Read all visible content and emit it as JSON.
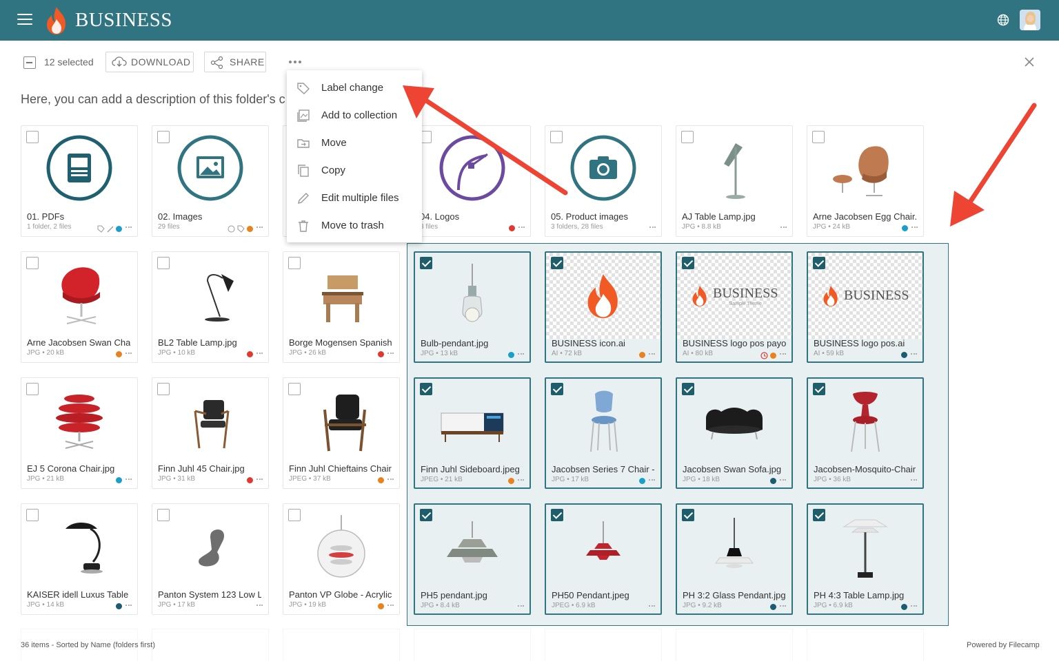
{
  "header": {
    "brand": "BUSINESS",
    "menu_icon": "hamburger-icon",
    "globe_icon": "globe-icon",
    "avatar": "user-avatar",
    "color": "#2f7480"
  },
  "toolbar": {
    "selected_text": "12 selected",
    "download_label": "DOWNLOAD",
    "share_label": "SHARE"
  },
  "description": "Here, you can add a description of this folder's c",
  "context_menu": {
    "items": [
      {
        "label": "Label change",
        "icon": "tag-icon"
      },
      {
        "label": "Add to collection",
        "icon": "collection-icon"
      },
      {
        "label": "Move",
        "icon": "move-icon"
      },
      {
        "label": "Copy",
        "icon": "copy-icon"
      },
      {
        "label": "Edit multiple files",
        "icon": "pencil-icon"
      },
      {
        "label": "Move to trash",
        "icon": "trash-icon"
      }
    ]
  },
  "files": [
    {
      "name": "01. PDFs",
      "meta": "1 folder, 2 files",
      "selected": false
    },
    {
      "name": "02. Images",
      "meta": "29 files",
      "selected": false
    },
    {
      "name": "04. Logos",
      "meta": "3 files",
      "selected": false
    },
    {
      "name": "05. Product images",
      "meta": "3 folders, 28 files",
      "selected": false
    },
    {
      "name": "AJ Table Lamp.jpg",
      "meta": "JPG • 8.8 kB",
      "selected": false
    },
    {
      "name": "Arne Jacobsen Egg Chair.",
      "meta": "JPG • 24 kB",
      "selected": false
    },
    {
      "name": "Arne Jacobsen Swan Chai",
      "meta": "JPG • 20 kB",
      "selected": false
    },
    {
      "name": "BL2 Table Lamp.jpg",
      "meta": "JPG • 10 kB",
      "selected": false
    },
    {
      "name": "Borge Mogensen Spanish",
      "meta": "JPG • 26 kB",
      "selected": false
    },
    {
      "name": "Bulb-pendant.jpg",
      "meta": "JPG • 13 kB",
      "selected": true
    },
    {
      "name": "BUSINESS icon.ai",
      "meta": "AI • 72 kB",
      "selected": true
    },
    {
      "name": "BUSINESS logo pos payof",
      "meta": "AI • 80 kB",
      "selected": true
    },
    {
      "name": "BUSINESS logo pos.ai",
      "meta": "AI • 59 kB",
      "selected": true
    },
    {
      "name": "EJ 5 Corona Chair.jpg",
      "meta": "JPG • 21 kB",
      "selected": false
    },
    {
      "name": "Finn Juhl 45 Chair.jpg",
      "meta": "JPG • 31 kB",
      "selected": false
    },
    {
      "name": "Finn Juhl Chieftains Chair",
      "meta": "JPEG • 37 kB",
      "selected": false
    },
    {
      "name": "Finn Juhl Sideboard.jpeg",
      "meta": "JPEG • 21 kB",
      "selected": true
    },
    {
      "name": "Jacobsen Series 7 Chair -",
      "meta": "JPG • 17 kB",
      "selected": true
    },
    {
      "name": "Jacobsen Swan Sofa.jpg",
      "meta": "JPG • 18 kB",
      "selected": true
    },
    {
      "name": "Jacobsen-Mosquito-Chair",
      "meta": "JPG • 36 kB",
      "selected": true
    },
    {
      "name": "KAISER idell Luxus Table L",
      "meta": "JPG • 14 kB",
      "selected": false
    },
    {
      "name": "Panton System 123 Low L",
      "meta": "JPG • 17 kB",
      "selected": false
    },
    {
      "name": "Panton VP Globe - Acrylic",
      "meta": "JPG • 19 kB",
      "selected": false
    },
    {
      "name": "PH5 pendant.jpg",
      "meta": "JPG • 8.4 kB",
      "selected": true
    },
    {
      "name": "PH50 Pendant.jpeg",
      "meta": "JPEG • 6.9 kB",
      "selected": true
    },
    {
      "name": "PH 3:2 Glass Pendant.jpg",
      "meta": "JPG • 9.2 kB",
      "selected": true
    },
    {
      "name": "PH 4:3 Table Lamp.jpg",
      "meta": "JPG • 6.9 kB",
      "selected": true
    }
  ],
  "logo_text": {
    "brand": "BUSINESS",
    "tagline": "Sample Theme"
  },
  "footer": {
    "status": "36 items - Sorted by Name (folders first)",
    "powered": "Powered by Filecamp"
  },
  "colors": {
    "teal": "#2f7480",
    "orange_tag": "#e8821e",
    "red_tag": "#e03a2f",
    "cyan_tag": "#1aa0c8",
    "navy_tag": "#1b5c72",
    "arrow": "#ee4433"
  }
}
